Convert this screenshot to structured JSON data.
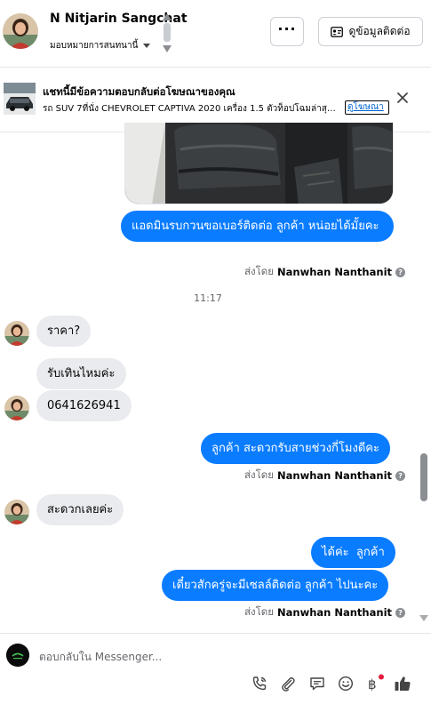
{
  "header": {
    "contact_name": "N Nitjarin Sangchat",
    "assign_label": "มอบหมายการสนทนานี้",
    "more_label": "···",
    "contact_info_label": "ดูข้อมูลติดต่อ"
  },
  "ad_banner": {
    "title": "แชทนี้มีข้อความตอบกลับต่อโฆษณาของคุณ",
    "description": "รถ SUV 7ที่นั่ง CHEVROLET CAPTIVA 2020 เครื่อง 1.5 ตัวท็อปโฉมล่าสุด ...",
    "link_label": "ดูโฆษณา"
  },
  "messages": [
    {
      "id": "m1",
      "direction": "out",
      "text": "แอดมินรบกวนขอเบอร์ติดต่อ ลูกค้า หน่อยได้มั้ยคะ"
    },
    {
      "id": "m2",
      "direction": "in",
      "text": "ราคา?"
    },
    {
      "id": "m3",
      "direction": "in",
      "text": "รับเทินไหมค่ะ"
    },
    {
      "id": "m4",
      "direction": "in",
      "text": "0641626941"
    },
    {
      "id": "m5",
      "direction": "out",
      "text": "ลูกค้า สะดวกรับสายช่วงกี่โมงดีคะ"
    },
    {
      "id": "m6",
      "direction": "in",
      "text": "สะดวกเลยค่ะ"
    },
    {
      "id": "m7",
      "direction": "out",
      "text": "ได้ค่ะ  ลูกค้า"
    },
    {
      "id": "m8",
      "direction": "out",
      "text": "เดี๋ยวสักครู่จะมีเซลล์ติดต่อ ลูกค้า ไปนะคะ"
    }
  ],
  "sent_by": {
    "prefix": "ส่งโดย",
    "name": "Nanwhan Nanthanit",
    "help": "?"
  },
  "time_separator": "11:17",
  "composer": {
    "placeholder": "ตอบกลับใน Messenger..."
  },
  "icons": [
    "chevron-up-icon",
    "chevron-down-icon",
    "contact-card-icon",
    "close-icon",
    "call-icon",
    "attachment-icon",
    "saved-reply-icon",
    "emoji-icon",
    "baht-icon",
    "thumbs-up-icon"
  ],
  "colors": {
    "outgoing_bubble": "#0a7cff",
    "incoming_bubble": "#e9ebee",
    "accent": "#0064d1"
  }
}
